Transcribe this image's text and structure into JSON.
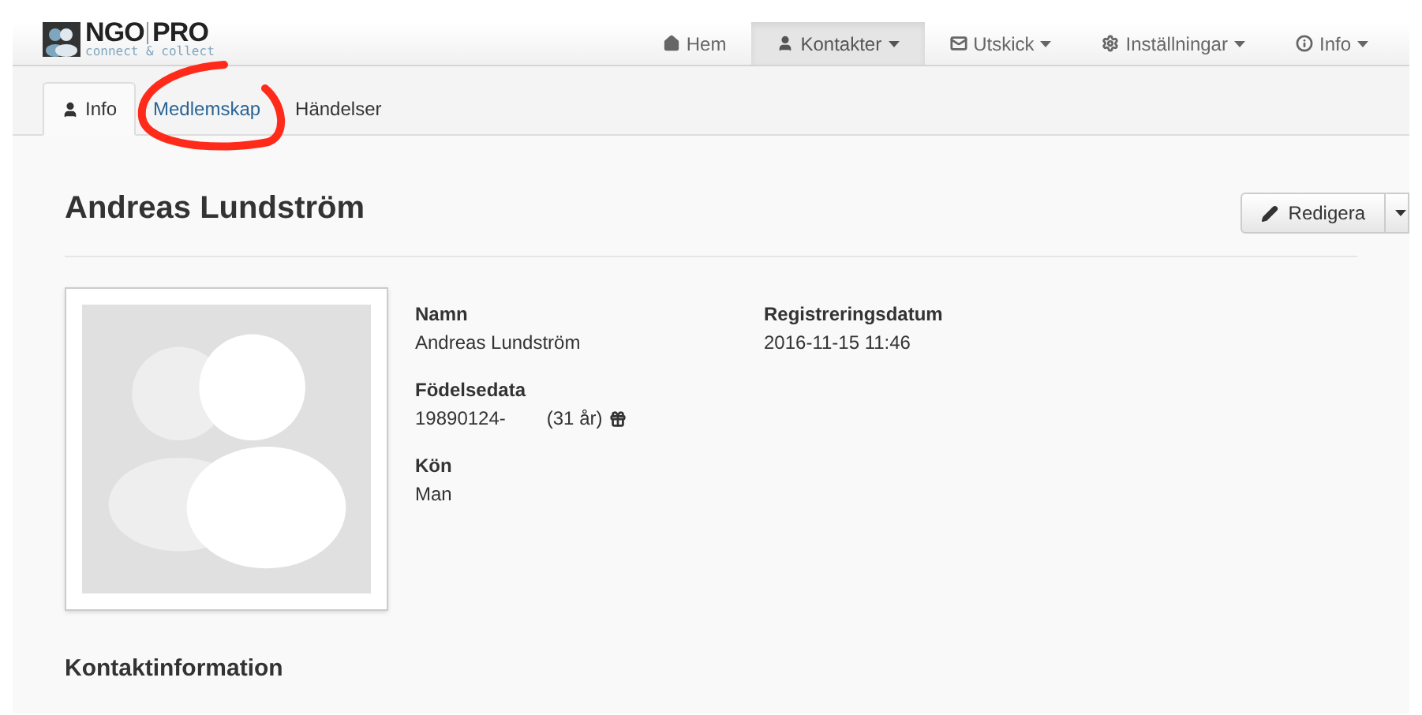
{
  "logo": {
    "name": "NGO",
    "suffix": "PRO",
    "tagline": "connect & collect"
  },
  "nav": [
    {
      "label": "Hem",
      "selected": false,
      "dropdown": false
    },
    {
      "label": "Kontakter",
      "selected": true,
      "dropdown": true
    },
    {
      "label": "Utskick",
      "selected": false,
      "dropdown": true
    },
    {
      "label": "Inställningar",
      "selected": false,
      "dropdown": true
    },
    {
      "label": "Info",
      "selected": false,
      "dropdown": true
    }
  ],
  "tabs": [
    {
      "label": "Info",
      "selected": true
    },
    {
      "label": "Medlemskap",
      "selected": false
    },
    {
      "label": "Händelser",
      "selected": false
    }
  ],
  "contact": {
    "title": "Andreas Lundström",
    "edit_button": "Redigera",
    "fields": [
      {
        "label": "Namn",
        "value": "Andreas Lundström"
      },
      {
        "label": "Födelsedata",
        "value": "19890124-",
        "extra": "(31 år)"
      },
      {
        "label": "Kön",
        "value": "Man"
      }
    ],
    "side_fields": [
      {
        "label": "Registreringsdatum",
        "value": "2016-11-15 11:46"
      }
    ],
    "section_title": "Kontaktinformation"
  }
}
